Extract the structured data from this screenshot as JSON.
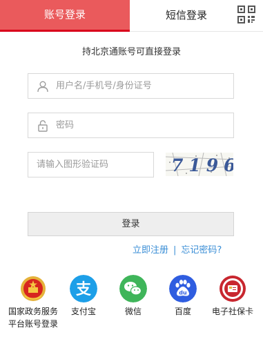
{
  "tabs": {
    "account": "账号登录",
    "sms": "短信登录"
  },
  "hint": "持北京通账号可直接登录",
  "fields": {
    "username_placeholder": "用户名/手机号/身份证号",
    "password_placeholder": "密码",
    "captcha_placeholder": "请输入图形验证码",
    "captcha_text": "7196"
  },
  "login_button": "登录",
  "links": {
    "register": "立即注册",
    "separator": "|",
    "forgot": "忘记密码?"
  },
  "third_party": [
    {
      "label1": "国家政务服务",
      "label2": "平台账号登录",
      "icon": "national-emblem-icon",
      "color": "#d7261f"
    },
    {
      "label1": "支付宝",
      "label2": "",
      "icon": "alipay-icon",
      "color": "#1d9fe8"
    },
    {
      "label1": "微信",
      "label2": "",
      "icon": "wechat-icon",
      "color": "#3fb55a"
    },
    {
      "label1": "百度",
      "label2": "",
      "icon": "baidu-icon",
      "color": "#2f5de0"
    },
    {
      "label1": "电子社保卡",
      "label2": "",
      "icon": "social-security-card-icon",
      "color": "#c8272f"
    }
  ]
}
